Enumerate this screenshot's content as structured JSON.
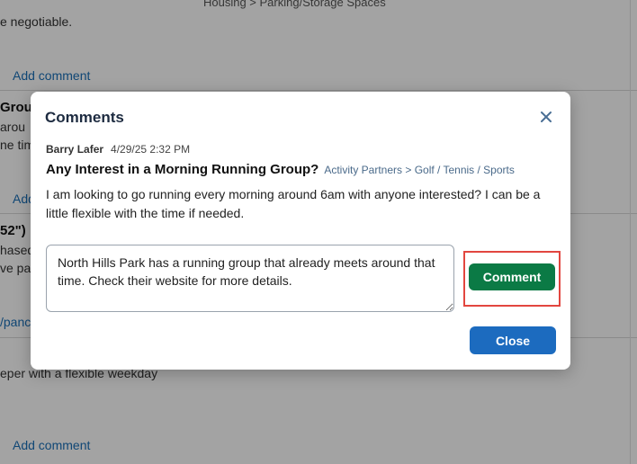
{
  "background": {
    "top_category": "Housing > Parking/Storage Spaces",
    "top_text": "e negotiable.",
    "add_comment_1": "Add comment",
    "group_heading": "Grou",
    "group_line1": "arou",
    "group_line2": "ne tim",
    "add_comment_2_partial": "Add",
    "size_heading": "52\")",
    "size_line1": "hased",
    "size_line2": "ve paid",
    "pano_link": "/panc",
    "keeper_text": "eper with a flexible weekday",
    "add_comment_3": "Add comment"
  },
  "modal": {
    "title": "Comments",
    "close_icon": "close-icon",
    "author": "Barry Lafer",
    "date": "4/29/25 2:32 PM",
    "post_title": "Any Interest in a Morning Running Group?",
    "post_category": "Activity Partners > Golf / Tennis / Sports",
    "post_body": "I am looking to go running every morning around 6am with anyone interested? I can be a little flexible with the time if needed.",
    "comment_value": "North Hills Park has a running group that already meets around that time. Check their website for more details.",
    "comment_button": "Comment",
    "close_button": "Close"
  },
  "colors": {
    "primary_blue": "#1c6bbf",
    "comment_green": "#0b7a45",
    "highlight_red": "#e2463f",
    "link_blue": "#1a6fb8"
  }
}
